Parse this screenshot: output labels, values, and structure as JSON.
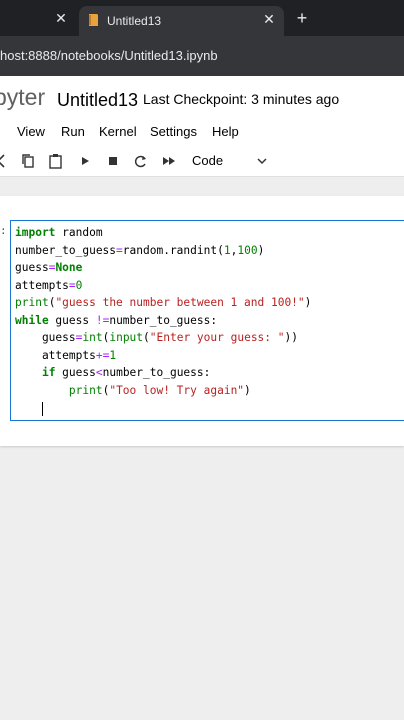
{
  "browser": {
    "inactive_tab_close": "✕",
    "active_tab_title": "Untitled13",
    "active_tab_close": "✕",
    "new_tab": "+",
    "url": "host:8888/notebooks/Untitled13.ipynb",
    "accent": "#e8a33d"
  },
  "header": {
    "brand_fragment": "pyter",
    "notebook_title": "Untitled13",
    "checkpoint": "Last Checkpoint: 3 minutes ago"
  },
  "menu": {
    "items": [
      "View",
      "Run",
      "Kernel",
      "Settings",
      "Help"
    ]
  },
  "toolbar": {
    "icons": [
      "cut-icon",
      "copy-icon",
      "paste-icon",
      "run-icon",
      "stop-icon",
      "restart-icon",
      "run-all-icon"
    ],
    "cell_type": "Code"
  },
  "cell": {
    "prompt": ":",
    "code": [
      [
        {
          "t": "import",
          "c": "kw"
        },
        {
          "t": " random",
          "c": "nm"
        }
      ],
      [
        {
          "t": "number_to_guess",
          "c": "nm"
        },
        {
          "t": "=",
          "c": "op"
        },
        {
          "t": "random.randint(",
          "c": "nm"
        },
        {
          "t": "1",
          "c": "num"
        },
        {
          "t": ",",
          "c": "nm"
        },
        {
          "t": "100",
          "c": "num"
        },
        {
          "t": ")",
          "c": "nm"
        }
      ],
      [
        {
          "t": "guess",
          "c": "nm"
        },
        {
          "t": "=",
          "c": "op"
        },
        {
          "t": "None",
          "c": "kw"
        }
      ],
      [
        {
          "t": "attempts",
          "c": "nm"
        },
        {
          "t": "=",
          "c": "op"
        },
        {
          "t": "0",
          "c": "num"
        }
      ],
      [
        {
          "t": "print",
          "c": "bi"
        },
        {
          "t": "(",
          "c": "nm"
        },
        {
          "t": "\"guess the number between 1 and 100!\"",
          "c": "str"
        },
        {
          "t": ")",
          "c": "nm"
        }
      ],
      [
        {
          "t": "while",
          "c": "kw"
        },
        {
          "t": " guess ",
          "c": "nm"
        },
        {
          "t": "!=",
          "c": "op"
        },
        {
          "t": "number_to_guess:",
          "c": "nm"
        }
      ],
      [
        {
          "t": "    guess",
          "c": "nm"
        },
        {
          "t": "=",
          "c": "op"
        },
        {
          "t": "int",
          "c": "bi"
        },
        {
          "t": "(",
          "c": "nm"
        },
        {
          "t": "input",
          "c": "bi"
        },
        {
          "t": "(",
          "c": "nm"
        },
        {
          "t": "\"Enter your guess: \"",
          "c": "str"
        },
        {
          "t": "))",
          "c": "nm"
        }
      ],
      [
        {
          "t": "    attempts",
          "c": "nm"
        },
        {
          "t": "+=",
          "c": "op"
        },
        {
          "t": "1",
          "c": "num"
        }
      ],
      [
        {
          "t": "    ",
          "c": "nm"
        },
        {
          "t": "if",
          "c": "kw"
        },
        {
          "t": " guess",
          "c": "nm"
        },
        {
          "t": "<",
          "c": "op"
        },
        {
          "t": "number_to_guess:",
          "c": "nm"
        }
      ],
      [
        {
          "t": "        ",
          "c": "nm"
        },
        {
          "t": "print",
          "c": "bi"
        },
        {
          "t": "(",
          "c": "nm"
        },
        {
          "t": "\"Too low! Try again\"",
          "c": "str"
        },
        {
          "t": ")",
          "c": "nm"
        }
      ],
      [
        {
          "t": "    ",
          "c": "nm"
        }
      ]
    ]
  }
}
